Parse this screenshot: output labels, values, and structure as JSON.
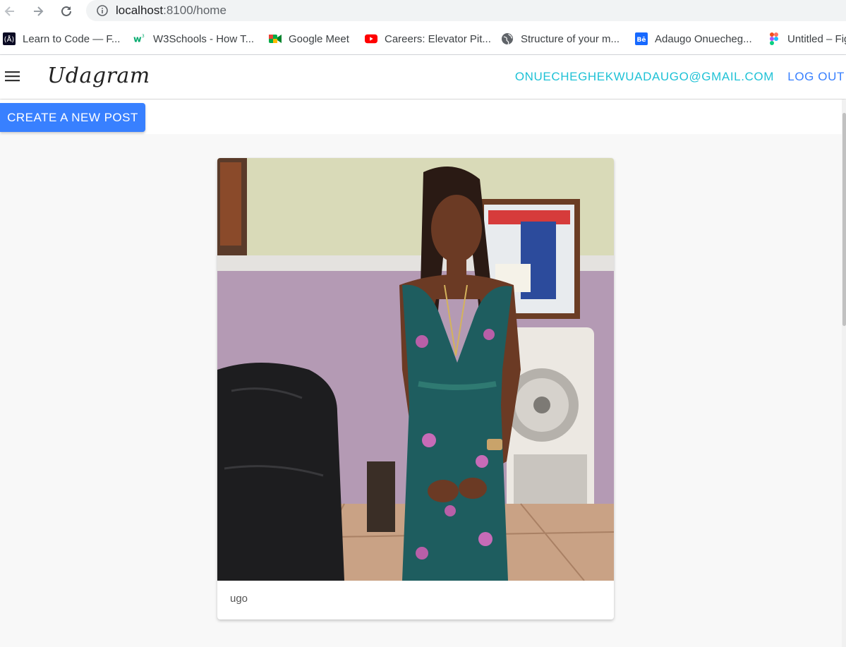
{
  "browser": {
    "url_host": "localhost",
    "url_path": ":8100/home",
    "bookmarks": [
      {
        "label": "Learn to Code — F...",
        "icon": "freecodecamp-icon"
      },
      {
        "label": "W3Schools - How T...",
        "icon": "w3schools-icon"
      },
      {
        "label": "Google Meet",
        "icon": "google-meet-icon"
      },
      {
        "label": "Careers: Elevator Pit...",
        "icon": "youtube-icon"
      },
      {
        "label": "Structure of your m...",
        "icon": "globe-icon"
      },
      {
        "label": "Adaugo Onuecheg...",
        "icon": "behance-icon"
      },
      {
        "label": "Untitled – Fig",
        "icon": "figma-icon"
      }
    ]
  },
  "app": {
    "brand": "Udagram",
    "user_email": "ONUECHEGHEKWUADAUGO@GMAIL.COM",
    "logout_label": "LOG OUT",
    "create_post_label": "CREATE A NEW POST"
  },
  "feed": {
    "posts": [
      {
        "caption": "ugo"
      }
    ]
  },
  "colors": {
    "primary": "#3880ff",
    "secondary": "#1fc2d6",
    "page_bg": "#f8f8f8"
  }
}
